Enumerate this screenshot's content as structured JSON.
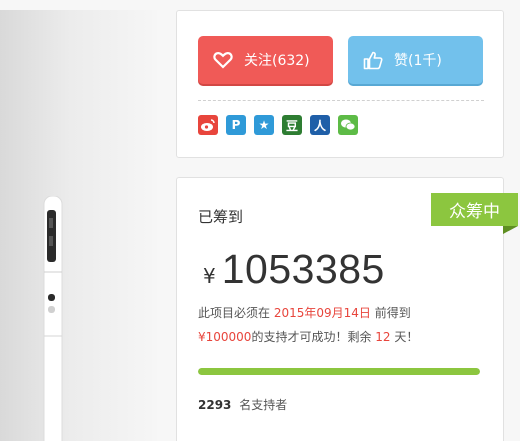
{
  "image": {
    "alt": ""
  },
  "actions": {
    "follow_label": "关注(632)",
    "like_label": "赞(1千)"
  },
  "share": [
    {
      "name": "weibo",
      "glyph": "",
      "color": "#e8453c"
    },
    {
      "name": "tencent-weibo",
      "glyph": "P",
      "color": "#2f9ad8"
    },
    {
      "name": "qzone",
      "glyph": "★",
      "color": "#2f9ad8"
    },
    {
      "name": "douban",
      "glyph": "豆",
      "color": "#2e7d32"
    },
    {
      "name": "renren",
      "glyph": "人",
      "color": "#1f5fa8"
    },
    {
      "name": "wechat",
      "glyph": "",
      "color": "#5dbb46"
    }
  ],
  "funding": {
    "badge": "众筹中",
    "raised_label": "已筹到",
    "currency": "¥",
    "amount": "1053385",
    "note_prefix": "此项目必须在",
    "deadline": "2015年09月14日",
    "note_suffix": "前得到",
    "goal": "¥100000",
    "goal_suffix": "的支持才可成功！剩余",
    "days_left": "12",
    "days_suffix": "天！",
    "progress": 1.0,
    "backers_count": "2293",
    "backers_label": "名支持者"
  },
  "colors": {
    "accent_green": "#8cc63f",
    "follow_red": "#f05a57",
    "like_blue": "#72c1ec",
    "highlight_red": "#e8453c"
  }
}
